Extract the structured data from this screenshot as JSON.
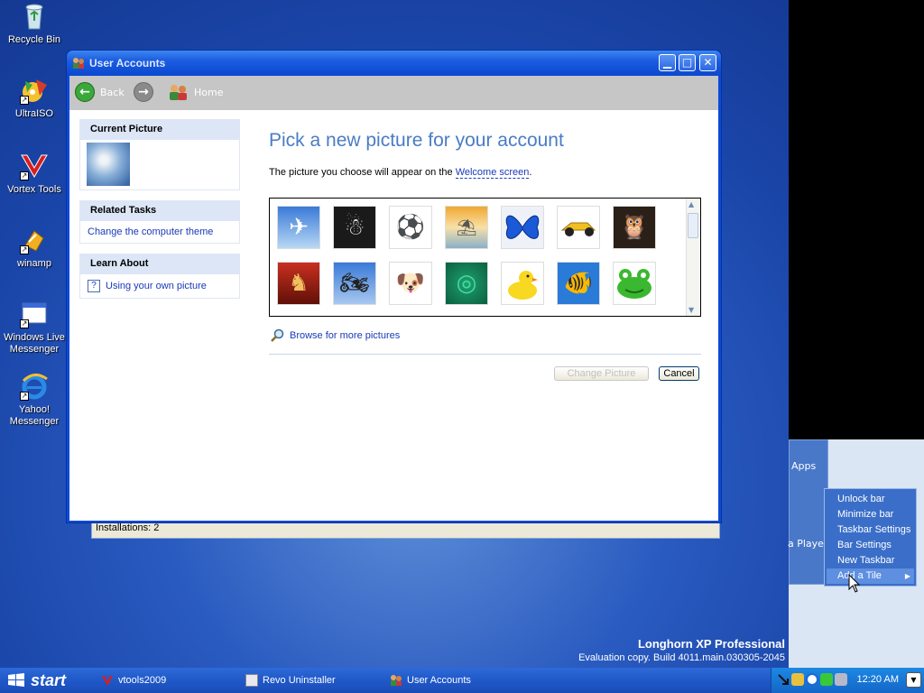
{
  "desktop": {
    "icons": [
      {
        "label": "Recycle Bin",
        "icon": "recycle-bin-icon"
      },
      {
        "label": "UltraISO",
        "icon": "ultraiso-icon"
      },
      {
        "label": "Vortex Tools",
        "icon": "vortex-icon"
      },
      {
        "label": "winamp",
        "icon": "winamp-icon"
      },
      {
        "label": "Windows Live Messenger",
        "icon": "messenger-icon"
      },
      {
        "label": "Yahoo! Messenger",
        "icon": "ie-icon"
      }
    ],
    "brand_title": "Longhorn XP Professional",
    "brand_build": "Evaluation copy. Build 4011.main.030305-2045"
  },
  "sidebar": {
    "tile1": "Apps",
    "tile2": "a Player"
  },
  "window": {
    "title": "User Accounts",
    "nav": {
      "back": "Back",
      "home": "Home"
    },
    "current_picture_title": "Current Picture",
    "related_tasks_title": "Related Tasks",
    "related_tasks": [
      "Change the computer theme"
    ],
    "learn_about_title": "Learn About",
    "learn_about": [
      "Using your own picture"
    ],
    "heading": "Pick a new picture for your account",
    "description_prefix": "The picture you choose will appear on the",
    "description_link": "Welcome screen",
    "description_suffix": ".",
    "pictures": [
      "airplane",
      "astronaut",
      "soccer-ball",
      "beach-chair",
      "butterfly",
      "race-car",
      "owl",
      "chess",
      "dirt-bike",
      "dog",
      "green-swirl",
      "rubber-duck",
      "fish",
      "frog"
    ],
    "browse_label": "Browse for more pictures",
    "change_button": "Change Picture",
    "cancel_button": "Cancel"
  },
  "status_bar": {
    "text": "Installations: 2"
  },
  "context_menu": {
    "items": [
      "Unlock bar",
      "Minimize bar",
      "Taskbar Settings",
      "Bar Settings",
      "New Taskbar",
      "Add a Tile"
    ],
    "selected": "Add a Tile"
  },
  "taskbar": {
    "start": "start",
    "tasks": [
      "vtools2009",
      "Revo Uninstaller",
      "User Accounts"
    ],
    "clock": "12:20 AM"
  }
}
